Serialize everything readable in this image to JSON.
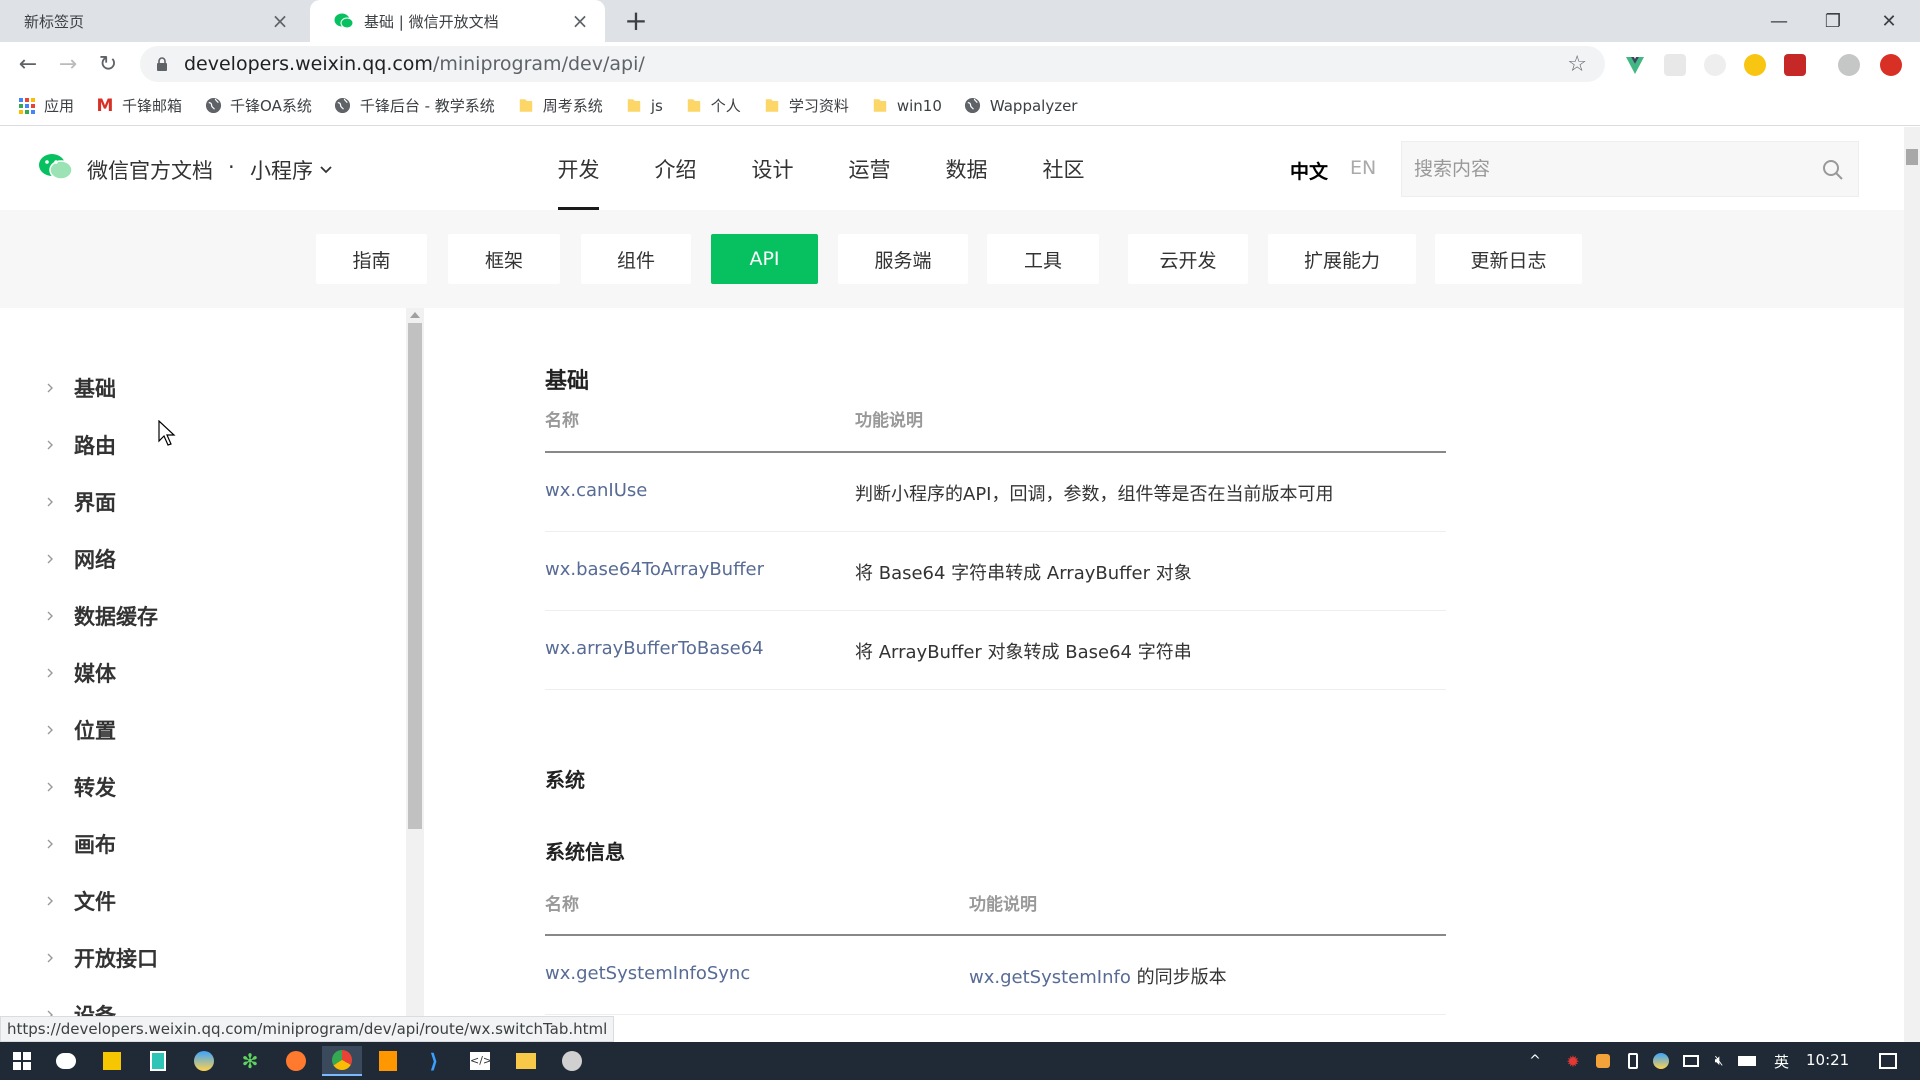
{
  "browser": {
    "tabs": [
      {
        "title": "新标签页",
        "active": false
      },
      {
        "title": "基础 | 微信开放文档",
        "active": true
      }
    ],
    "url_host": "developers.weixin.qq.com",
    "url_path": "/miniprogram/dev/api/",
    "bookmarks": [
      {
        "label": "应用",
        "icon": "apps-grid-icon"
      },
      {
        "label": "千锋邮箱",
        "icon": "gmail-icon"
      },
      {
        "label": "千锋OA系统",
        "icon": "globe-icon"
      },
      {
        "label": "千锋后台 - 教学系统",
        "icon": "globe-icon"
      },
      {
        "label": "周考系统",
        "icon": "folder-icon"
      },
      {
        "label": "js",
        "icon": "folder-icon"
      },
      {
        "label": "个人",
        "icon": "folder-icon"
      },
      {
        "label": "学习资料",
        "icon": "folder-icon"
      },
      {
        "label": "win10",
        "icon": "folder-icon"
      },
      {
        "label": "Wappalyzer",
        "icon": "globe-icon"
      }
    ],
    "status_url": "https://developers.weixin.qq.com/miniprogram/dev/api/route/wx.switchTab.html"
  },
  "header": {
    "brand": "微信官方文档",
    "dot": "·",
    "product": "小程序",
    "nav": [
      "开发",
      "介绍",
      "设计",
      "运营",
      "数据",
      "社区"
    ],
    "nav_active": "开发",
    "lang_zh": "中文",
    "lang_en": "EN",
    "search_placeholder": "搜索内容"
  },
  "subnav": [
    "指南",
    "框架",
    "组件",
    "API",
    "服务端",
    "工具",
    "云开发",
    "扩展能力",
    "更新日志"
  ],
  "subnav_active": "API",
  "sidebar": [
    "基础",
    "路由",
    "界面",
    "网络",
    "数据缓存",
    "媒体",
    "位置",
    "转发",
    "画布",
    "文件",
    "开放接口",
    "设备"
  ],
  "content": {
    "section1_title": "基础",
    "table1": {
      "headers": [
        "名称",
        "功能说明"
      ],
      "rows": [
        {
          "name": "wx.canIUse",
          "desc": "判断小程序的API，回调，参数，组件等是否在当前版本可用"
        },
        {
          "name": "wx.base64ToArrayBuffer",
          "desc": "将 Base64 字符串转成 ArrayBuffer 对象"
        },
        {
          "name": "wx.arrayBufferToBase64",
          "desc": "将 ArrayBuffer 对象转成 Base64 字符串"
        }
      ]
    },
    "section2_title": "系统",
    "section2_sub": "系统信息",
    "table2": {
      "headers": [
        "名称",
        "功能说明"
      ],
      "rows": [
        {
          "name": "wx.getSystemInfoSync",
          "desc_link": "wx.getSystemInfo",
          "desc": " 的同步版本"
        }
      ]
    }
  },
  "taskbar": {
    "ime": "英",
    "clock": "10:21"
  },
  "colors": {
    "accent": "#07c160",
    "link": "#576b95"
  }
}
